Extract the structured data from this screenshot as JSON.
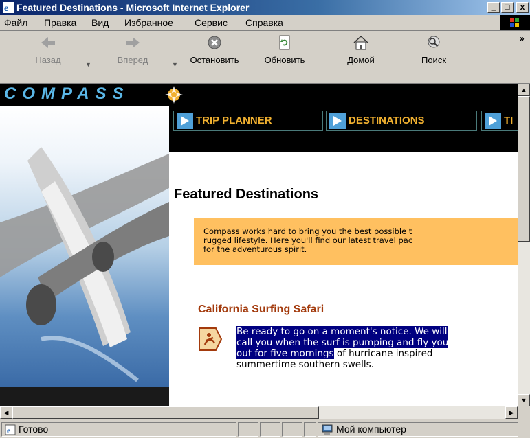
{
  "window": {
    "title": "Featured Destinations - Microsoft Internet Explorer",
    "controls": {
      "minimize": "_",
      "maximize": "□",
      "close": "x"
    }
  },
  "menu": {
    "file": "Файл",
    "edit": "Правка",
    "view": "Вид",
    "favorites": "Избранное",
    "tools": "Сервис",
    "help": "Справка"
  },
  "toolbar": {
    "back": "Назад",
    "forward": "Вперед",
    "stop": "Остановить",
    "refresh": "Обновить",
    "home": "Домой",
    "search": "Поиск",
    "more": "»"
  },
  "page": {
    "brand": "COMPASS",
    "nav": [
      "TRIP PLANNER",
      "DESTINATIONS",
      "TI"
    ],
    "heading": "Featured Destinations",
    "intro": "Compass works hard to bring you the best possible t\nrugged lifestyle. Here you'll find our latest travel pac\nfor the adventurous spirit.",
    "item": {
      "title": "California Surfing Safari",
      "desc_selected": "Be ready to go on a moment's notice. We will\ncall you when the surf is pumping and fly you\nout for five mornings",
      "desc_rest": " of hurricane inspired\nsummertime southern swells."
    },
    "colors": {
      "accent": "#f0b030",
      "heading2": "#a33a0c",
      "intro_bg": "#ffc060",
      "selection": "#000080",
      "logo": "#5bb8e8"
    }
  },
  "status": {
    "text": "Готово",
    "zone": "Мой компьютер"
  }
}
